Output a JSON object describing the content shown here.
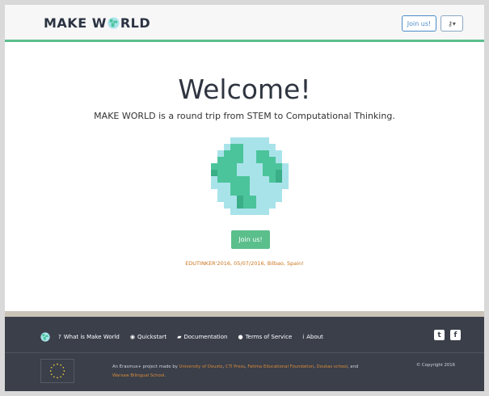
{
  "header": {
    "brand_prefix": "MAKE W",
    "brand_suffix": "RLD",
    "join_label": "Join us!",
    "login_icon": "key-icon",
    "login_caret": "▾"
  },
  "main": {
    "title": "Welcome!",
    "tagline": "MAKE WORLD is a round trip from STEM to Computational Thinking.",
    "join_label": "Join us!",
    "event": "EDUTINKER'2016, 05/07/2016, Bilbao, Spain!"
  },
  "footer": {
    "nav": [
      {
        "icon": "?",
        "label": "What is Make World"
      },
      {
        "icon": "◉",
        "label": "Quickstart"
      },
      {
        "icon": "▰",
        "label": "Documentation"
      },
      {
        "icon": "●",
        "label": "Terms of Service"
      },
      {
        "icon": "i",
        "label": "About"
      }
    ],
    "twitter_glyph": "t",
    "facebook_glyph": "f",
    "credits": {
      "prefix": "An Erasmus+ project made by ",
      "org1": "University of Deusto",
      "sep1": ", ",
      "org2": "CTI Press",
      "sep2": ", ",
      "org3": "Fatima Educational Foundation",
      "sep3": ", ",
      "org4": "Doukas school",
      "sep4": ", and",
      "org5": "Warsaw Bilingual School",
      "suffix": "."
    },
    "copyright": "© Copyright 2016"
  },
  "colors": {
    "accent": "#5bbf8c",
    "footer_bg": "#3a3f4a",
    "link_orange": "#d88a3a",
    "globe_water": "#a9e3ea",
    "globe_land": "#4cc49b"
  }
}
